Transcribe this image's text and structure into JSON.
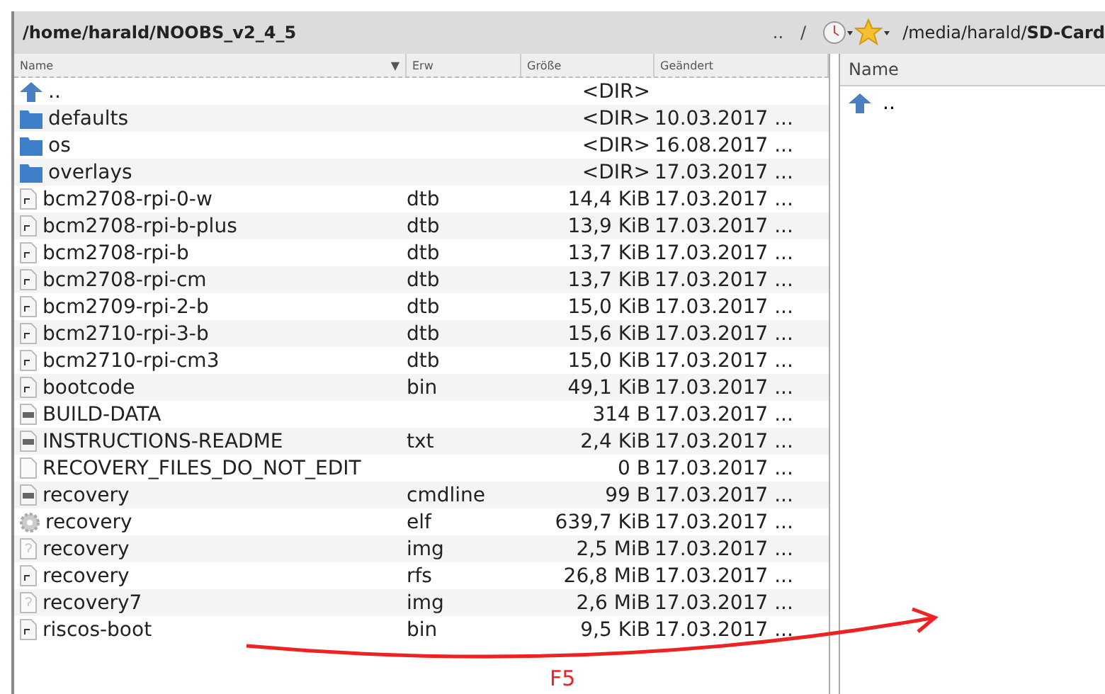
{
  "left_panel": {
    "path": "/home/harald/NOOBS_v2_4_5",
    "columns": [
      {
        "label": "Name",
        "sort_indicator": "▼"
      },
      {
        "label": "Erw"
      },
      {
        "label": "Größe"
      },
      {
        "label": "Geändert"
      }
    ],
    "rows": [
      {
        "kind": "up",
        "name": "..",
        "ext": "",
        "size": "<DIR>",
        "date": ""
      },
      {
        "kind": "folder",
        "name": "defaults",
        "ext": "",
        "size": "<DIR>",
        "date": "10.03.2017 ..."
      },
      {
        "kind": "folder",
        "name": "os",
        "ext": "",
        "size": "<DIR>",
        "date": "16.08.2017 ..."
      },
      {
        "kind": "folder",
        "name": "overlays",
        "ext": "",
        "size": "<DIR>",
        "date": "17.03.2017 ..."
      },
      {
        "kind": "binary",
        "name": "bcm2708-rpi-0-w",
        "ext": "dtb",
        "size": "14,4 KiB",
        "date": "17.03.2017 ..."
      },
      {
        "kind": "binary",
        "name": "bcm2708-rpi-b-plus",
        "ext": "dtb",
        "size": "13,9 KiB",
        "date": "17.03.2017 ..."
      },
      {
        "kind": "binary",
        "name": "bcm2708-rpi-b",
        "ext": "dtb",
        "size": "13,7 KiB",
        "date": "17.03.2017 ..."
      },
      {
        "kind": "binary",
        "name": "bcm2708-rpi-cm",
        "ext": "dtb",
        "size": "13,7 KiB",
        "date": "17.03.2017 ..."
      },
      {
        "kind": "binary",
        "name": "bcm2709-rpi-2-b",
        "ext": "dtb",
        "size": "15,0 KiB",
        "date": "17.03.2017 ..."
      },
      {
        "kind": "binary",
        "name": "bcm2710-rpi-3-b",
        "ext": "dtb",
        "size": "15,6 KiB",
        "date": "17.03.2017 ..."
      },
      {
        "kind": "binary",
        "name": "bcm2710-rpi-cm3",
        "ext": "dtb",
        "size": "15,0 KiB",
        "date": "17.03.2017 ..."
      },
      {
        "kind": "binary",
        "name": "bootcode",
        "ext": "bin",
        "size": "49,1 KiB",
        "date": "17.03.2017 ..."
      },
      {
        "kind": "text",
        "name": "BUILD-DATA",
        "ext": "",
        "size": "314 B",
        "date": "17.03.2017 ..."
      },
      {
        "kind": "text",
        "name": "INSTRUCTIONS-README",
        "ext": "txt",
        "size": "2,4 KiB",
        "date": "17.03.2017 ..."
      },
      {
        "kind": "blank",
        "name": "RECOVERY_FILES_DO_NOT_EDIT",
        "ext": "",
        "size": "0 B",
        "date": "17.03.2017 ..."
      },
      {
        "kind": "text",
        "name": "recovery",
        "ext": "cmdline",
        "size": "99 B",
        "date": "17.03.2017 ..."
      },
      {
        "kind": "gear",
        "name": "recovery",
        "ext": "elf",
        "size": "639,7 KiB",
        "date": "17.03.2017 ..."
      },
      {
        "kind": "unknown",
        "name": "recovery",
        "ext": "img",
        "size": "2,5 MiB",
        "date": "17.03.2017 ..."
      },
      {
        "kind": "binary",
        "name": "recovery",
        "ext": "rfs",
        "size": "26,8 MiB",
        "date": "17.03.2017 ..."
      },
      {
        "kind": "unknown",
        "name": "recovery7",
        "ext": "img",
        "size": "2,6 MiB",
        "date": "17.03.2017 ..."
      },
      {
        "kind": "binary",
        "name": "riscos-boot",
        "ext": "bin",
        "size": "9,5 KiB",
        "date": "17.03.2017 ..."
      }
    ]
  },
  "right_panel": {
    "nav": [
      "..",
      "/"
    ],
    "path": "/media/harald/**SD-Card**",
    "columns": [
      {
        "label": "Name"
      }
    ],
    "rows": [
      {
        "kind": "up",
        "name": ".."
      }
    ]
  },
  "annotation": {
    "label": "F5"
  }
}
